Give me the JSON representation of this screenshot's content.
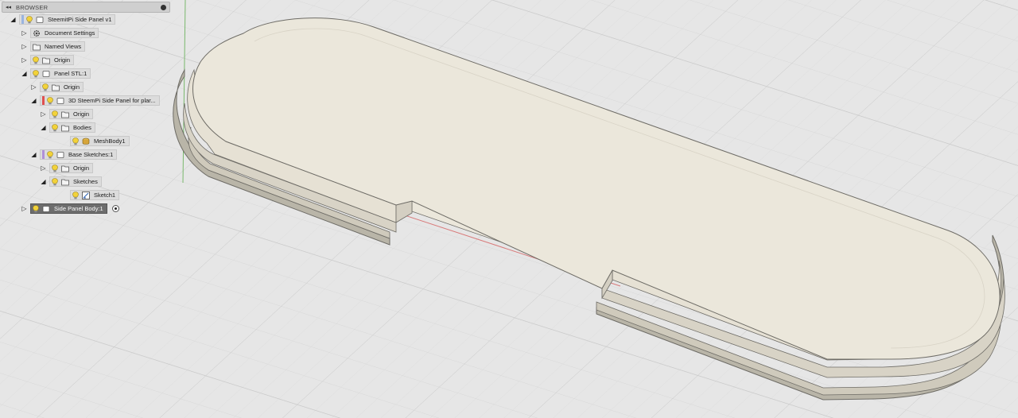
{
  "browser": {
    "title": "BROWSER",
    "items": [
      {
        "label": "SteemitPi Side Panel v1",
        "expanded": true,
        "icon": "component-icon",
        "bulb": true,
        "bar": "#9ab4e0"
      },
      {
        "label": "Document Settings",
        "expanded": false,
        "icon": "gear-icon",
        "bulb": false
      },
      {
        "label": "Named Views",
        "expanded": false,
        "icon": "folder-icon",
        "bulb": false
      },
      {
        "label": "Origin",
        "expanded": false,
        "icon": "folder-icon",
        "bulb": true
      },
      {
        "label": "Panel STL:1",
        "expanded": true,
        "icon": "component-icon",
        "bulb": true
      },
      {
        "label": "Origin",
        "expanded": false,
        "icon": "folder-icon",
        "bulb": true
      },
      {
        "label": "3D SteemPi Side Panel for plar...",
        "expanded": true,
        "icon": "component-icon",
        "bulb": true,
        "bar": "#e05050"
      },
      {
        "label": "Origin",
        "expanded": false,
        "icon": "folder-icon",
        "bulb": true
      },
      {
        "label": "Bodies",
        "expanded": true,
        "icon": "folder-icon",
        "bulb": true
      },
      {
        "label": "MeshBody1",
        "expanded": null,
        "icon": "mesh-body-icon",
        "bulb": true
      },
      {
        "label": "Base Sketches:1",
        "expanded": true,
        "icon": "component-icon",
        "bulb": true,
        "bar": "#b090d8"
      },
      {
        "label": "Origin",
        "expanded": false,
        "icon": "folder-icon",
        "bulb": true
      },
      {
        "label": "Sketches",
        "expanded": true,
        "icon": "folder-icon",
        "bulb": true
      },
      {
        "label": "Sketch1",
        "expanded": null,
        "icon": "sketch-icon",
        "bulb": true
      },
      {
        "label": "Side Panel Body:1",
        "expanded": false,
        "icon": "component-icon",
        "bulb": true,
        "active": true
      }
    ]
  }
}
